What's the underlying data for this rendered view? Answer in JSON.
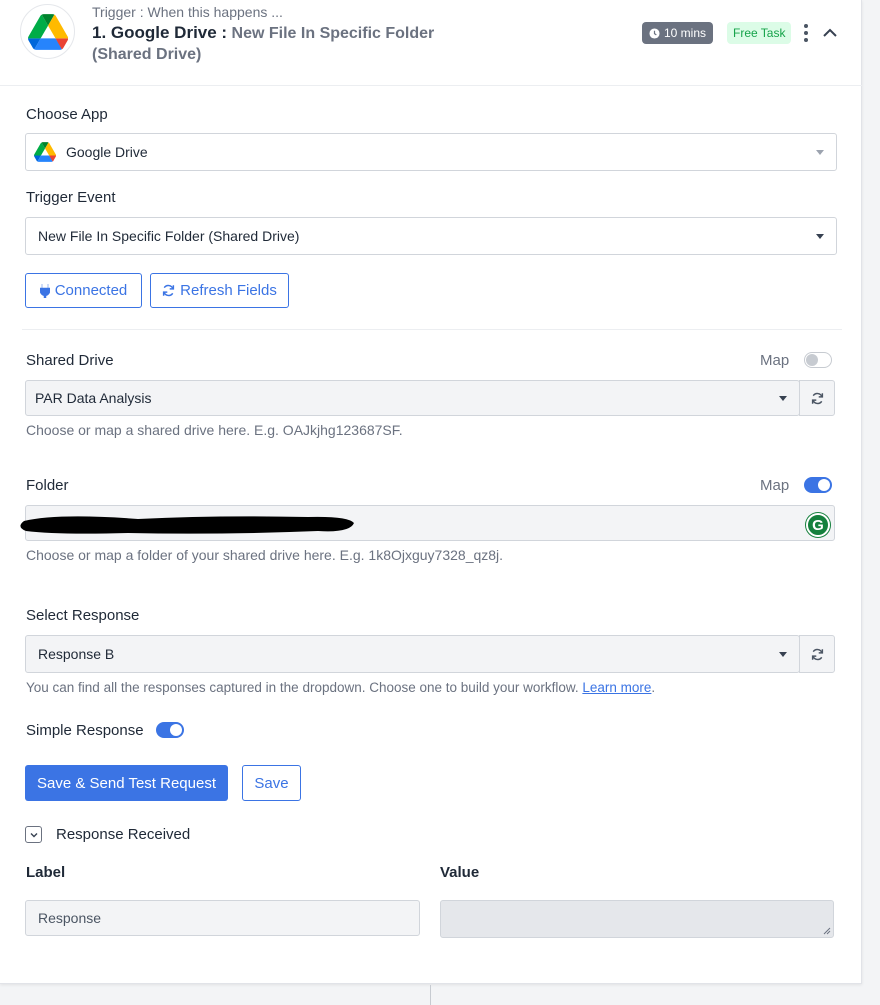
{
  "header": {
    "caption": "Trigger : When this happens ...",
    "app_name": "1. Google Drive :",
    "event_name": "New File In Specific Folder (Shared Drive)",
    "time_badge": "10 mins",
    "task_badge": "Free Task"
  },
  "choose_app": {
    "label": "Choose App",
    "value": "Google Drive"
  },
  "trigger_event": {
    "label": "Trigger Event",
    "value": "New File In Specific Folder (Shared Drive)"
  },
  "buttons": {
    "connected": "Connected",
    "refresh_fields": "Refresh Fields",
    "save_send": "Save & Send Test Request",
    "save": "Save"
  },
  "shared_drive": {
    "label": "Shared Drive",
    "map_label": "Map",
    "map_on": false,
    "value": "PAR Data Analysis",
    "help": "Choose or map a shared drive here. E.g. OAJkjhg123687SF."
  },
  "folder": {
    "label": "Folder",
    "map_label": "Map",
    "map_on": true,
    "help": "Choose or map a folder of your shared drive here. E.g. 1k8Ojxguy7328_qz8j."
  },
  "select_response": {
    "label": "Select Response",
    "value": "Response B",
    "help": "You can find all the responses captured in the dropdown. Choose one to build your workflow.",
    "learn_more": "Learn more",
    "period": "."
  },
  "simple_response": {
    "label": "Simple Response",
    "on": true
  },
  "response_received": {
    "label": "Response Received",
    "col_label": "Label",
    "col_value": "Value",
    "row_label": "Response",
    "row_value": ""
  },
  "colors": {
    "accent": "#3b74e4",
    "badge_gray": "#6b7280",
    "free_badge_bg": "#dcfce7",
    "free_badge_text": "#16a34a"
  }
}
